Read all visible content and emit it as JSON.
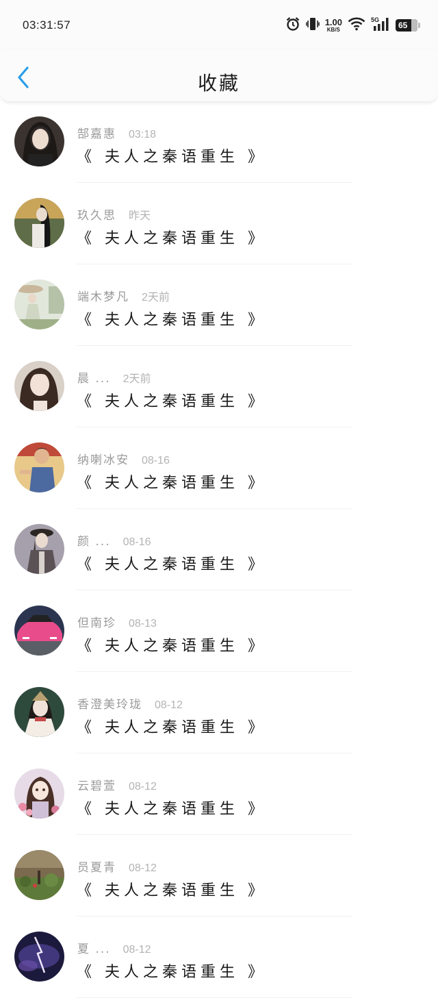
{
  "status": {
    "time": "03:31:57",
    "net_speed": "1.00",
    "net_unit": "KB/S",
    "network": "5G",
    "battery": "65"
  },
  "header": {
    "title": "收藏"
  },
  "colors": {
    "accent": "#2a9de8"
  },
  "items": [
    {
      "name": "郜嘉惠",
      "time": "03:18",
      "book": "《 夫人之秦语重生 》"
    },
    {
      "name": "玖久思",
      "time": "昨天",
      "book": "《 夫人之秦语重生 》"
    },
    {
      "name": "端木梦凡",
      "time": "2天前",
      "book": "《 夫人之秦语重生 》"
    },
    {
      "name": "晨 ...",
      "time": "2天前",
      "book": "《 夫人之秦语重生 》"
    },
    {
      "name": "纳喇冰安",
      "time": "08-16",
      "book": "《 夫人之秦语重生 》"
    },
    {
      "name": "颜 ...",
      "time": "08-16",
      "book": "《 夫人之秦语重生 》"
    },
    {
      "name": "但南珍",
      "time": "08-13",
      "book": "《 夫人之秦语重生 》"
    },
    {
      "name": "香澄美玲珑",
      "time": "08-12",
      "book": "《 夫人之秦语重生 》"
    },
    {
      "name": "云碧萱",
      "time": "08-12",
      "book": "《 夫人之秦语重生 》"
    },
    {
      "name": "员夏青",
      "time": "08-12",
      "book": "《 夫人之秦语重生 》"
    },
    {
      "name": "夏 ...",
      "time": "08-12",
      "book": "《 夫人之秦语重生 》"
    }
  ]
}
